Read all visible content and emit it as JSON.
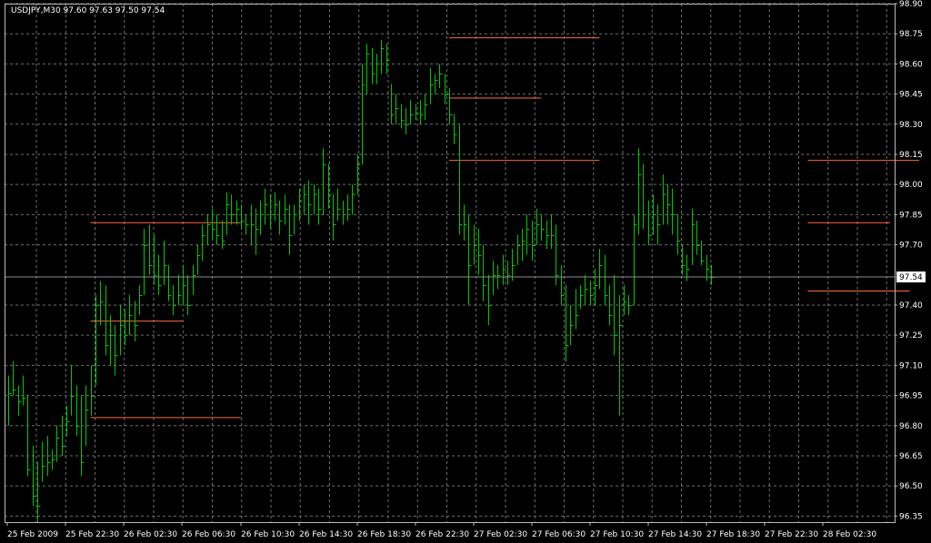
{
  "symbol_header": "USDJPY,M30  97.60 97.63 97.50 97.54",
  "colors": {
    "background": "#000000",
    "grid": "#6e6e6e",
    "bar": "#00c800",
    "level_line": "#ff6a3c",
    "price_line": "#8c8c8c",
    "axis_text": "#ffffff",
    "price_tag_bg": "#ffffff",
    "price_tag_text": "#000000"
  },
  "chart_data": {
    "type": "ohlc",
    "timeframe": "M30",
    "y_axis": {
      "ticks": [
        "98.90",
        "98.75",
        "98.60",
        "98.45",
        "98.30",
        "98.15",
        "98.00",
        "97.85",
        "97.70",
        "97.54",
        "97.40",
        "97.25",
        "97.10",
        "96.95",
        "96.80",
        "96.65",
        "96.50",
        "96.35"
      ],
      "min": 96.32,
      "max": 98.9
    },
    "x_axis": {
      "labels": [
        "25 Feb 2009",
        "25 Feb 22:30",
        "26 Feb 02:30",
        "26 Feb 06:30",
        "26 Feb 10:30",
        "26 Feb 14:30",
        "26 Feb 18:30",
        "26 Feb 22:30",
        "27 Feb 02:30",
        "27 Feb 06:30",
        "27 Feb 10:30",
        "27 Feb 14:30",
        "27 Feb 18:30",
        "27 Feb 22:30",
        "28 Feb 02:30"
      ]
    },
    "last_price": 97.54,
    "grid": true,
    "bars": [
      {
        "h": 97.05,
        "l": 96.8,
        "c": 96.96
      },
      {
        "h": 97.12,
        "l": 96.95,
        "c": 96.98
      },
      {
        "h": 97.0,
        "l": 96.85,
        "c": 96.92
      },
      {
        "h": 97.05,
        "l": 96.9,
        "c": 96.94
      },
      {
        "h": 96.95,
        "l": 96.55,
        "c": 96.58
      },
      {
        "h": 96.7,
        "l": 96.4,
        "c": 96.45
      },
      {
        "h": 96.62,
        "l": 96.32,
        "c": 96.4
      },
      {
        "h": 96.72,
        "l": 96.52,
        "c": 96.6
      },
      {
        "h": 96.75,
        "l": 96.55,
        "c": 96.62
      },
      {
        "h": 96.68,
        "l": 96.58,
        "c": 96.63
      },
      {
        "h": 96.8,
        "l": 96.62,
        "c": 96.74
      },
      {
        "h": 96.85,
        "l": 96.65,
        "c": 96.7
      },
      {
        "h": 96.9,
        "l": 96.75,
        "c": 96.82
      },
      {
        "h": 97.1,
        "l": 96.85,
        "c": 96.95
      },
      {
        "h": 97.0,
        "l": 96.75,
        "c": 96.8
      },
      {
        "h": 96.95,
        "l": 96.55,
        "c": 96.62
      },
      {
        "h": 97.0,
        "l": 96.7,
        "c": 96.88
      },
      {
        "h": 97.1,
        "l": 96.85,
        "c": 96.95
      },
      {
        "h": 97.45,
        "l": 97.0,
        "c": 97.4
      },
      {
        "h": 97.52,
        "l": 97.3,
        "c": 97.42
      },
      {
        "h": 97.5,
        "l": 97.15,
        "c": 97.2
      },
      {
        "h": 97.35,
        "l": 97.1,
        "c": 97.25
      },
      {
        "h": 97.3,
        "l": 97.05,
        "c": 97.15
      },
      {
        "h": 97.4,
        "l": 97.15,
        "c": 97.3
      },
      {
        "h": 97.38,
        "l": 97.2,
        "c": 97.25
      },
      {
        "h": 97.45,
        "l": 97.25,
        "c": 97.35
      },
      {
        "h": 97.42,
        "l": 97.22,
        "c": 97.3
      },
      {
        "h": 97.5,
        "l": 97.35,
        "c": 97.45
      },
      {
        "h": 97.78,
        "l": 97.45,
        "c": 97.7
      },
      {
        "h": 97.8,
        "l": 97.55,
        "c": 97.6
      },
      {
        "h": 97.75,
        "l": 97.5,
        "c": 97.55
      },
      {
        "h": 97.65,
        "l": 97.45,
        "c": 97.5
      },
      {
        "h": 97.72,
        "l": 97.5,
        "c": 97.6
      },
      {
        "h": 97.6,
        "l": 97.42,
        "c": 97.45
      },
      {
        "h": 97.5,
        "l": 97.35,
        "c": 97.4
      },
      {
        "h": 97.55,
        "l": 97.4,
        "c": 97.45
      },
      {
        "h": 97.6,
        "l": 97.4,
        "c": 97.5
      },
      {
        "h": 97.55,
        "l": 97.35,
        "c": 97.4
      },
      {
        "h": 97.6,
        "l": 97.45,
        "c": 97.55
      },
      {
        "h": 97.7,
        "l": 97.55,
        "c": 97.65
      },
      {
        "h": 97.8,
        "l": 97.62,
        "c": 97.75
      },
      {
        "h": 97.85,
        "l": 97.7,
        "c": 97.8
      },
      {
        "h": 97.88,
        "l": 97.72,
        "c": 97.78
      },
      {
        "h": 97.85,
        "l": 97.7,
        "c": 97.75
      },
      {
        "h": 97.82,
        "l": 97.68,
        "c": 97.72
      },
      {
        "h": 97.96,
        "l": 97.75,
        "c": 97.9
      },
      {
        "h": 97.95,
        "l": 97.8,
        "c": 97.85
      },
      {
        "h": 97.92,
        "l": 97.8,
        "c": 97.88
      },
      {
        "h": 97.9,
        "l": 97.78,
        "c": 97.82
      },
      {
        "h": 97.85,
        "l": 97.75,
        "c": 97.8
      },
      {
        "h": 97.9,
        "l": 97.7,
        "c": 97.8
      },
      {
        "h": 97.88,
        "l": 97.65,
        "c": 97.78
      },
      {
        "h": 97.92,
        "l": 97.75,
        "c": 97.85
      },
      {
        "h": 97.98,
        "l": 97.8,
        "c": 97.9
      },
      {
        "h": 97.95,
        "l": 97.78,
        "c": 97.85
      },
      {
        "h": 97.96,
        "l": 97.82,
        "c": 97.9
      },
      {
        "h": 97.92,
        "l": 97.75,
        "c": 97.82
      },
      {
        "h": 97.95,
        "l": 97.8,
        "c": 97.88
      },
      {
        "h": 97.9,
        "l": 97.65,
        "c": 97.75
      },
      {
        "h": 97.9,
        "l": 97.75,
        "c": 97.85
      },
      {
        "h": 97.98,
        "l": 97.82,
        "c": 97.92
      },
      {
        "h": 98.0,
        "l": 97.85,
        "c": 97.95
      },
      {
        "h": 98.02,
        "l": 97.8,
        "c": 97.9
      },
      {
        "h": 98.0,
        "l": 97.85,
        "c": 97.95
      },
      {
        "h": 97.98,
        "l": 97.8,
        "c": 97.88
      },
      {
        "h": 98.18,
        "l": 97.85,
        "c": 98.1
      },
      {
        "h": 98.1,
        "l": 97.88,
        "c": 97.95
      },
      {
        "h": 97.95,
        "l": 97.72,
        "c": 97.8
      },
      {
        "h": 97.98,
        "l": 97.82,
        "c": 97.88
      },
      {
        "h": 97.92,
        "l": 97.8,
        "c": 97.85
      },
      {
        "h": 97.95,
        "l": 97.82,
        "c": 97.88
      },
      {
        "h": 98.0,
        "l": 97.85,
        "c": 97.95
      },
      {
        "h": 98.15,
        "l": 97.95,
        "c": 98.1
      },
      {
        "h": 98.6,
        "l": 98.1,
        "c": 98.5
      },
      {
        "h": 98.7,
        "l": 98.45,
        "c": 98.65
      },
      {
        "h": 98.68,
        "l": 98.5,
        "c": 98.55
      },
      {
        "h": 98.65,
        "l": 98.5,
        "c": 98.6
      },
      {
        "h": 98.72,
        "l": 98.55,
        "c": 98.68
      },
      {
        "h": 98.7,
        "l": 98.55,
        "c": 98.62
      },
      {
        "h": 98.5,
        "l": 98.3,
        "c": 98.35
      },
      {
        "h": 98.45,
        "l": 98.3,
        "c": 98.38
      },
      {
        "h": 98.4,
        "l": 98.28,
        "c": 98.32
      },
      {
        "h": 98.38,
        "l": 98.25,
        "c": 98.3
      },
      {
        "h": 98.42,
        "l": 98.3,
        "c": 98.35
      },
      {
        "h": 98.4,
        "l": 98.32,
        "c": 98.36
      },
      {
        "h": 98.42,
        "l": 98.3,
        "c": 98.35
      },
      {
        "h": 98.45,
        "l": 98.32,
        "c": 98.4
      },
      {
        "h": 98.58,
        "l": 98.4,
        "c": 98.5
      },
      {
        "h": 98.55,
        "l": 98.45,
        "c": 98.52
      },
      {
        "h": 98.6,
        "l": 98.48,
        "c": 98.55
      },
      {
        "h": 98.55,
        "l": 98.4,
        "c": 98.45
      },
      {
        "h": 98.48,
        "l": 98.3,
        "c": 98.35
      },
      {
        "h": 98.35,
        "l": 98.2,
        "c": 98.25
      },
      {
        "h": 98.3,
        "l": 97.75,
        "c": 97.8
      },
      {
        "h": 97.9,
        "l": 97.72,
        "c": 97.8
      },
      {
        "h": 97.85,
        "l": 97.4,
        "c": 97.6
      },
      {
        "h": 97.8,
        "l": 97.6,
        "c": 97.7
      },
      {
        "h": 97.78,
        "l": 97.55,
        "c": 97.65
      },
      {
        "h": 97.7,
        "l": 97.42,
        "c": 97.5
      },
      {
        "h": 97.55,
        "l": 97.3,
        "c": 97.4
      },
      {
        "h": 97.62,
        "l": 97.45,
        "c": 97.55
      },
      {
        "h": 97.6,
        "l": 97.48,
        "c": 97.55
      },
      {
        "h": 97.65,
        "l": 97.5,
        "c": 97.58
      },
      {
        "h": 97.62,
        "l": 97.5,
        "c": 97.55
      },
      {
        "h": 97.68,
        "l": 97.52,
        "c": 97.6
      },
      {
        "h": 97.75,
        "l": 97.6,
        "c": 97.7
      },
      {
        "h": 97.78,
        "l": 97.62,
        "c": 97.72
      },
      {
        "h": 97.85,
        "l": 97.65,
        "c": 97.78
      },
      {
        "h": 97.82,
        "l": 97.62,
        "c": 97.7
      },
      {
        "h": 97.88,
        "l": 97.7,
        "c": 97.8
      },
      {
        "h": 97.85,
        "l": 97.72,
        "c": 97.78
      },
      {
        "h": 97.82,
        "l": 97.68,
        "c": 97.75
      },
      {
        "h": 97.85,
        "l": 97.68,
        "c": 97.75
      },
      {
        "h": 97.8,
        "l": 97.5,
        "c": 97.55
      },
      {
        "h": 97.6,
        "l": 97.4,
        "c": 97.45
      },
      {
        "h": 97.5,
        "l": 97.12,
        "c": 97.2
      },
      {
        "h": 97.4,
        "l": 97.2,
        "c": 97.3
      },
      {
        "h": 97.48,
        "l": 97.28,
        "c": 97.35
      },
      {
        "h": 97.5,
        "l": 97.38,
        "c": 97.45
      },
      {
        "h": 97.55,
        "l": 97.4,
        "c": 97.48
      },
      {
        "h": 97.52,
        "l": 97.4,
        "c": 97.45
      },
      {
        "h": 97.58,
        "l": 97.4,
        "c": 97.5
      },
      {
        "h": 97.68,
        "l": 97.48,
        "c": 97.6
      },
      {
        "h": 97.65,
        "l": 97.4,
        "c": 97.45
      },
      {
        "h": 97.5,
        "l": 97.3,
        "c": 97.35
      },
      {
        "h": 97.55,
        "l": 97.15,
        "c": 97.25
      },
      {
        "h": 97.45,
        "l": 96.85,
        "c": 97.3
      },
      {
        "h": 97.5,
        "l": 97.35,
        "c": 97.42
      },
      {
        "h": 97.45,
        "l": 97.35,
        "c": 97.4
      },
      {
        "h": 97.85,
        "l": 97.4,
        "c": 97.8
      },
      {
        "h": 98.18,
        "l": 97.75,
        "c": 98.05
      },
      {
        "h": 98.1,
        "l": 97.78,
        "c": 97.85
      },
      {
        "h": 97.92,
        "l": 97.7,
        "c": 97.75
      },
      {
        "h": 97.95,
        "l": 97.75,
        "c": 97.85
      },
      {
        "h": 97.9,
        "l": 97.7,
        "c": 97.8
      },
      {
        "h": 98.05,
        "l": 97.8,
        "c": 97.95
      },
      {
        "h": 98.0,
        "l": 97.8,
        "c": 97.9
      },
      {
        "h": 97.98,
        "l": 97.75,
        "c": 97.85
      },
      {
        "h": 97.85,
        "l": 97.65,
        "c": 97.72
      },
      {
        "h": 97.7,
        "l": 97.55,
        "c": 97.6
      },
      {
        "h": 97.65,
        "l": 97.52,
        "c": 97.58
      },
      {
        "h": 97.88,
        "l": 97.6,
        "c": 97.8
      },
      {
        "h": 97.82,
        "l": 97.65,
        "c": 97.7
      },
      {
        "h": 97.72,
        "l": 97.6,
        "c": 97.62
      },
      {
        "h": 97.65,
        "l": 97.52,
        "c": 97.58
      },
      {
        "h": 97.6,
        "l": 97.5,
        "c": 97.54
      }
    ],
    "levels": [
      {
        "price": 96.84,
        "from": 17,
        "to": 48
      },
      {
        "price": 97.32,
        "from": 17,
        "to": 36
      },
      {
        "price": 97.81,
        "from": 17,
        "to": 48
      },
      {
        "price": 98.73,
        "from": 91,
        "to": 122
      },
      {
        "price": 98.43,
        "from": 91,
        "to": 110
      },
      {
        "price": 98.12,
        "from": 91,
        "to": 122
      },
      {
        "price": 98.12,
        "from": 165,
        "to": 188
      },
      {
        "price": 97.81,
        "from": 165,
        "to": 182
      },
      {
        "price": 97.47,
        "from": 165,
        "to": 186
      }
    ]
  }
}
